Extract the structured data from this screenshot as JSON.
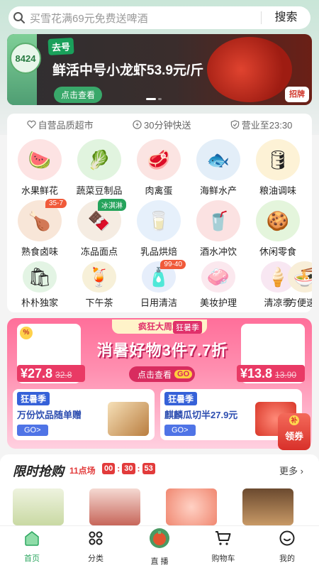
{
  "search": {
    "placeholder": "买雪花满69元免费送啤酒",
    "button_label": "搜索"
  },
  "banner": {
    "corner_badge": "8424",
    "tag": "去号",
    "title": "鲜活中号小龙虾53.9元/斤",
    "cta": "点击查看",
    "sticker": "招牌"
  },
  "trust_row": [
    {
      "icon": "heart-shield-icon",
      "label": "自营品质超市"
    },
    {
      "icon": "lightning-icon",
      "label": "30分钟快送"
    },
    {
      "icon": "shield-check-icon",
      "label": "营业至23:30"
    }
  ],
  "categories": [
    {
      "label": "水果鲜花",
      "icon": "watermelon-icon",
      "tag": ""
    },
    {
      "label": "蔬菜豆制品",
      "icon": "vegetable-icon",
      "tag": ""
    },
    {
      "label": "肉禽蛋",
      "icon": "meat-icon",
      "tag": ""
    },
    {
      "label": "海鲜水产",
      "icon": "fish-icon",
      "tag": ""
    },
    {
      "label": "粮油调味",
      "icon": "oil-icon",
      "tag": ""
    },
    {
      "label": "熟食卤味",
      "icon": "roast-icon",
      "tag": "35-7"
    },
    {
      "label": "冻品面点",
      "icon": "icecream-icon",
      "tag": "冰淇淋"
    },
    {
      "label": "乳品烘焙",
      "icon": "milk-icon",
      "tag": ""
    },
    {
      "label": "酒水冲饮",
      "icon": "cola-icon",
      "tag": ""
    },
    {
      "label": "休闲零食",
      "icon": "snack-icon",
      "tag": ""
    },
    {
      "label": "朴朴独家",
      "icon": "bag-icon",
      "tag": ""
    },
    {
      "label": "下午茶",
      "icon": "tea-icon",
      "tag": ""
    },
    {
      "label": "日用清洁",
      "icon": "detergent-icon",
      "tag": "99-40"
    },
    {
      "label": "美妆护理",
      "icon": "lotion-icon",
      "tag": ""
    },
    {
      "label": "清凉季",
      "icon": "cone-icon",
      "tag": ""
    },
    {
      "label": "方便速",
      "icon": "noodle-icon",
      "tag": ""
    }
  ],
  "promo": {
    "header_left": "疯狂大周末",
    "header_right": "狂暑季",
    "discount_icon": "%",
    "headline": "消暑好物3件7.7折",
    "cta": "点击查看",
    "cta_go": "GO",
    "left_price": "¥27.8",
    "left_was": "32.8",
    "right_price": "¥13.8",
    "right_was": "13.90",
    "card_left": {
      "badge": "狂暑季",
      "text": "万份饮品随单赠",
      "go": "GO>"
    },
    "card_right": {
      "badge": "狂暑季",
      "text": "麒麟瓜切半27.9元",
      "go": "GO>"
    }
  },
  "coupon": {
    "mini": "补",
    "label": "领券"
  },
  "flash_sale": {
    "title": "限时抢购",
    "slot": "11点场",
    "hours": "00",
    "minutes": "30",
    "seconds": "53",
    "more": "更多"
  },
  "tabbar": [
    {
      "label": "首页",
      "icon": "home-icon",
      "active": true
    },
    {
      "label": "分类",
      "icon": "grid-icon",
      "active": false
    },
    {
      "label": "直 播",
      "icon": "live-icon",
      "active": false
    },
    {
      "label": "购物车",
      "icon": "cart-icon",
      "active": false
    },
    {
      "label": "我的",
      "icon": "profile-icon",
      "active": false
    }
  ],
  "colors": {
    "accent_green": "#2da760",
    "promo_pink": "#ff6f9a",
    "sale_red": "#e23b3b"
  }
}
